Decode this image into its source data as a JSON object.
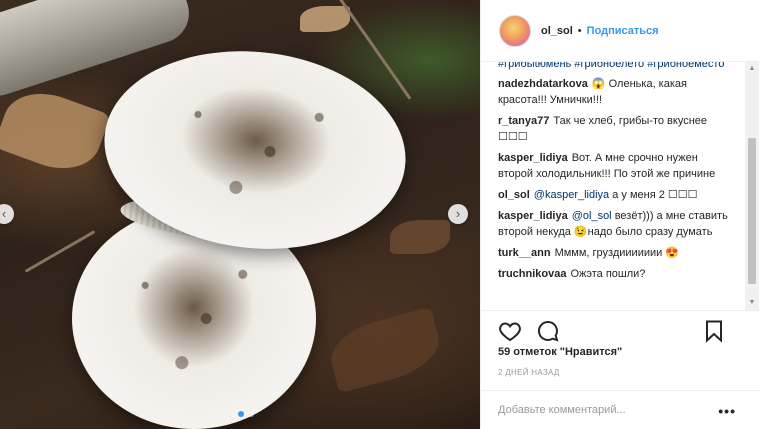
{
  "post": {
    "username": "ol_sol",
    "separator": "•",
    "follow_label": "Подписаться",
    "hashtags": "#грибыtюмень #грибноелето #грибноеместо",
    "comments": [
      {
        "user": "nadezhdatarkova",
        "text": "😱 Оленька, какая красота!!! Умнички!!!"
      },
      {
        "user": "r_tanya77",
        "text": "Так че хлеб, грибы-то вкуснее ☐☐☐"
      },
      {
        "user": "kasper_lidiya",
        "text": "Вот. А мне срочно нужен второй холодильник!!! По этой же причине"
      },
      {
        "user": "ol_sol",
        "mention": "@kasper_lidiya",
        "text": " а у меня 2 ☐☐☐"
      },
      {
        "user": "kasper_lidiya",
        "mention": "@ol_sol",
        "text": " везёт))) а мне ставить второй некуда 😉надо было сразу думать"
      },
      {
        "user": "turk__ann",
        "text": "Мммм, груздиииииии 😍"
      },
      {
        "user": "truchnikovaa",
        "text": "Ожэта пошли?"
      }
    ],
    "likes_text": "59 отметок \"Нравится\"",
    "time_text": "2 ДНЕЙ НАЗАД",
    "comment_placeholder": "Добавьте комментарий...",
    "more_label": "•••"
  },
  "icons": {
    "like": "heart-icon",
    "comment": "speech-bubble-icon",
    "share": "paper-plane-icon",
    "save": "bookmark-icon",
    "prev": "chevron-left-icon",
    "next": "chevron-right-icon"
  },
  "colors": {
    "link": "#3897f0",
    "hashtag": "#003569",
    "border": "#efefef",
    "muted": "#999999"
  }
}
